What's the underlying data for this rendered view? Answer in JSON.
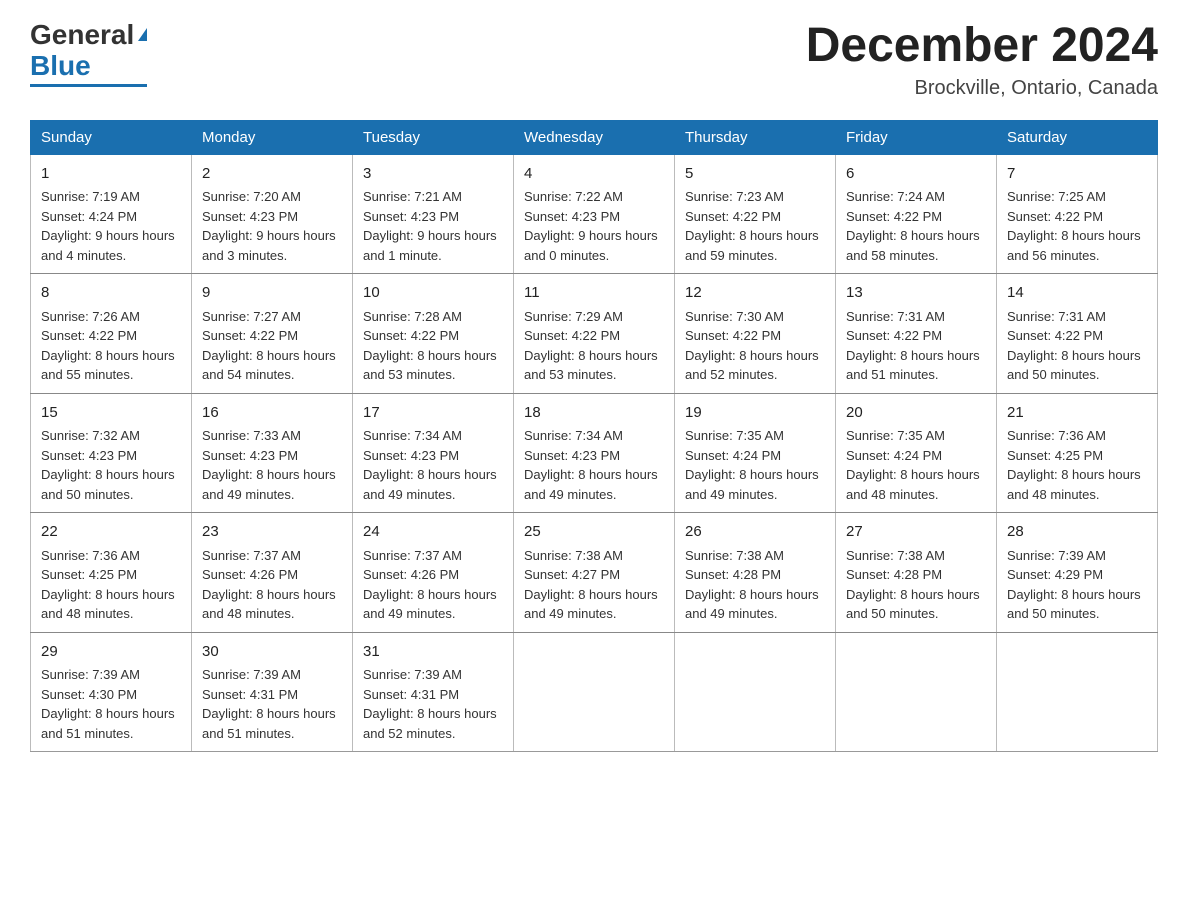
{
  "header": {
    "logo_general": "General",
    "logo_blue": "Blue",
    "month_title": "December 2024",
    "location": "Brockville, Ontario, Canada"
  },
  "weekdays": [
    "Sunday",
    "Monday",
    "Tuesday",
    "Wednesday",
    "Thursday",
    "Friday",
    "Saturday"
  ],
  "weeks": [
    [
      {
        "day": "1",
        "sunrise": "7:19 AM",
        "sunset": "4:24 PM",
        "daylight": "9 hours and 4 minutes."
      },
      {
        "day": "2",
        "sunrise": "7:20 AM",
        "sunset": "4:23 PM",
        "daylight": "9 hours and 3 minutes."
      },
      {
        "day": "3",
        "sunrise": "7:21 AM",
        "sunset": "4:23 PM",
        "daylight": "9 hours and 1 minute."
      },
      {
        "day": "4",
        "sunrise": "7:22 AM",
        "sunset": "4:23 PM",
        "daylight": "9 hours and 0 minutes."
      },
      {
        "day": "5",
        "sunrise": "7:23 AM",
        "sunset": "4:22 PM",
        "daylight": "8 hours and 59 minutes."
      },
      {
        "day": "6",
        "sunrise": "7:24 AM",
        "sunset": "4:22 PM",
        "daylight": "8 hours and 58 minutes."
      },
      {
        "day": "7",
        "sunrise": "7:25 AM",
        "sunset": "4:22 PM",
        "daylight": "8 hours and 56 minutes."
      }
    ],
    [
      {
        "day": "8",
        "sunrise": "7:26 AM",
        "sunset": "4:22 PM",
        "daylight": "8 hours and 55 minutes."
      },
      {
        "day": "9",
        "sunrise": "7:27 AM",
        "sunset": "4:22 PM",
        "daylight": "8 hours and 54 minutes."
      },
      {
        "day": "10",
        "sunrise": "7:28 AM",
        "sunset": "4:22 PM",
        "daylight": "8 hours and 53 minutes."
      },
      {
        "day": "11",
        "sunrise": "7:29 AM",
        "sunset": "4:22 PM",
        "daylight": "8 hours and 53 minutes."
      },
      {
        "day": "12",
        "sunrise": "7:30 AM",
        "sunset": "4:22 PM",
        "daylight": "8 hours and 52 minutes."
      },
      {
        "day": "13",
        "sunrise": "7:31 AM",
        "sunset": "4:22 PM",
        "daylight": "8 hours and 51 minutes."
      },
      {
        "day": "14",
        "sunrise": "7:31 AM",
        "sunset": "4:22 PM",
        "daylight": "8 hours and 50 minutes."
      }
    ],
    [
      {
        "day": "15",
        "sunrise": "7:32 AM",
        "sunset": "4:23 PM",
        "daylight": "8 hours and 50 minutes."
      },
      {
        "day": "16",
        "sunrise": "7:33 AM",
        "sunset": "4:23 PM",
        "daylight": "8 hours and 49 minutes."
      },
      {
        "day": "17",
        "sunrise": "7:34 AM",
        "sunset": "4:23 PM",
        "daylight": "8 hours and 49 minutes."
      },
      {
        "day": "18",
        "sunrise": "7:34 AM",
        "sunset": "4:23 PM",
        "daylight": "8 hours and 49 minutes."
      },
      {
        "day": "19",
        "sunrise": "7:35 AM",
        "sunset": "4:24 PM",
        "daylight": "8 hours and 49 minutes."
      },
      {
        "day": "20",
        "sunrise": "7:35 AM",
        "sunset": "4:24 PM",
        "daylight": "8 hours and 48 minutes."
      },
      {
        "day": "21",
        "sunrise": "7:36 AM",
        "sunset": "4:25 PM",
        "daylight": "8 hours and 48 minutes."
      }
    ],
    [
      {
        "day": "22",
        "sunrise": "7:36 AM",
        "sunset": "4:25 PM",
        "daylight": "8 hours and 48 minutes."
      },
      {
        "day": "23",
        "sunrise": "7:37 AM",
        "sunset": "4:26 PM",
        "daylight": "8 hours and 48 minutes."
      },
      {
        "day": "24",
        "sunrise": "7:37 AM",
        "sunset": "4:26 PM",
        "daylight": "8 hours and 49 minutes."
      },
      {
        "day": "25",
        "sunrise": "7:38 AM",
        "sunset": "4:27 PM",
        "daylight": "8 hours and 49 minutes."
      },
      {
        "day": "26",
        "sunrise": "7:38 AM",
        "sunset": "4:28 PM",
        "daylight": "8 hours and 49 minutes."
      },
      {
        "day": "27",
        "sunrise": "7:38 AM",
        "sunset": "4:28 PM",
        "daylight": "8 hours and 50 minutes."
      },
      {
        "day": "28",
        "sunrise": "7:39 AM",
        "sunset": "4:29 PM",
        "daylight": "8 hours and 50 minutes."
      }
    ],
    [
      {
        "day": "29",
        "sunrise": "7:39 AM",
        "sunset": "4:30 PM",
        "daylight": "8 hours and 51 minutes."
      },
      {
        "day": "30",
        "sunrise": "7:39 AM",
        "sunset": "4:31 PM",
        "daylight": "8 hours and 51 minutes."
      },
      {
        "day": "31",
        "sunrise": "7:39 AM",
        "sunset": "4:31 PM",
        "daylight": "8 hours and 52 minutes."
      },
      null,
      null,
      null,
      null
    ]
  ],
  "labels": {
    "sunrise": "Sunrise:",
    "sunset": "Sunset:",
    "daylight": "Daylight:"
  }
}
